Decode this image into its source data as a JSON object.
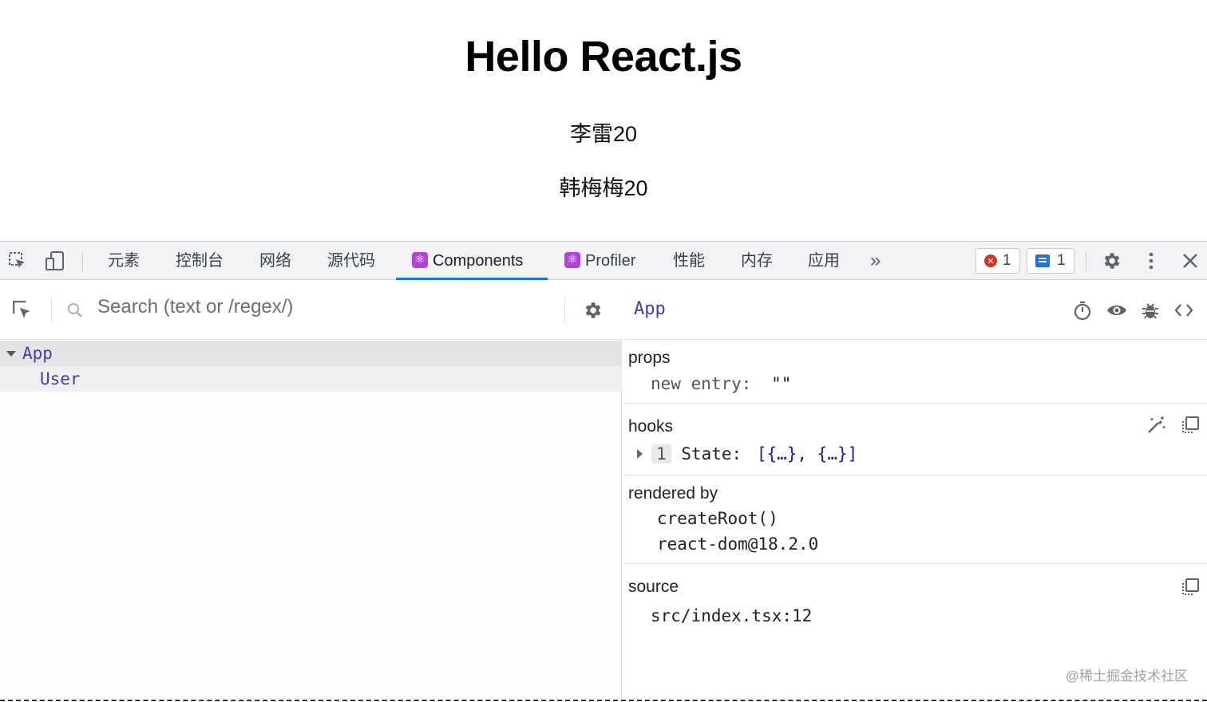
{
  "page": {
    "title": "Hello React.js",
    "users": [
      "李雷20",
      "韩梅梅20"
    ]
  },
  "devtools": {
    "tabs": [
      {
        "label": "元素",
        "active": false
      },
      {
        "label": "控制台",
        "active": false
      },
      {
        "label": "网络",
        "active": false
      },
      {
        "label": "源代码",
        "active": false
      },
      {
        "label": "Components",
        "active": true
      },
      {
        "label": "Profiler",
        "active": false
      },
      {
        "label": "性能",
        "active": false
      },
      {
        "label": "内存",
        "active": false
      },
      {
        "label": "应用",
        "active": false
      }
    ],
    "more_label": "»",
    "error_count": "1",
    "message_count": "1"
  },
  "components": {
    "search_placeholder": "Search (text or /regex/)",
    "tree": [
      {
        "name": "App",
        "selected": true
      },
      {
        "name": "User",
        "selected": false
      }
    ]
  },
  "inspector": {
    "component_name": "App",
    "props": {
      "title": "props",
      "key": "new entry",
      "value": "\"\""
    },
    "hooks": {
      "title": "hooks",
      "index": "1",
      "name": "State:",
      "value": "[{…}, {…}]"
    },
    "rendered_by": {
      "title": "rendered by",
      "items": [
        "createRoot()",
        "react-dom@18.2.0"
      ]
    },
    "source": {
      "title": "source",
      "location": "src/index.tsx:12"
    }
  },
  "watermark": "@稀土掘金技术社区",
  "colors": {
    "accent": "#1a73e8",
    "component_name": "#4a3aa8",
    "react_badge": "#b044d8",
    "error": "#d93025"
  }
}
